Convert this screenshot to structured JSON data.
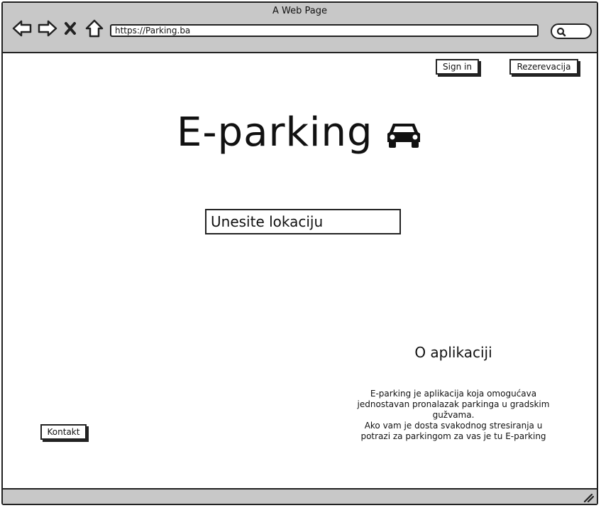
{
  "window": {
    "title": "A Web Page"
  },
  "browser": {
    "url": "https://Parking.ba",
    "back_icon": "back-arrow-icon",
    "forward_icon": "forward-arrow-icon",
    "stop_icon": "close-icon",
    "home_icon": "home-icon",
    "search_icon": "search-icon"
  },
  "header": {
    "sign_in_label": "Sign in",
    "reservation_label": "Rezerevacija"
  },
  "hero": {
    "title": "E-parking",
    "icon": "car-icon"
  },
  "search": {
    "placeholder": "Unesite lokaciju"
  },
  "about": {
    "heading": "O aplikaciji",
    "text": "E-parking je aplikacija koja omogućava\njednostavan pronalazak parkinga u gradskim\ngužvama.\nAko vam je dosta svakodnog stresiranja u\npotrazi za parkingom za vas je tu E-parking"
  },
  "footer": {
    "contact_label": "Kontakt"
  },
  "colors": {
    "chrome": "#c8c8c8",
    "ink": "#222222",
    "background": "#ffffff"
  }
}
